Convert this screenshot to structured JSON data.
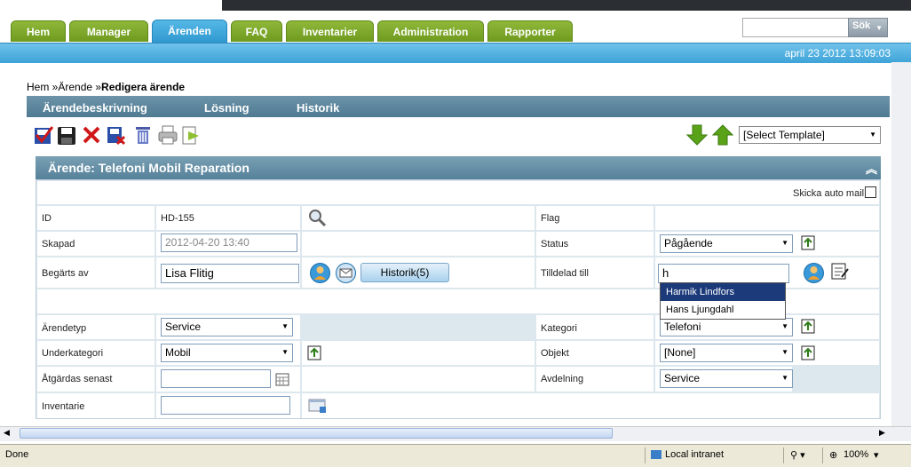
{
  "nav": {
    "tabs": [
      "Hem",
      "Manager",
      "Ärenden",
      "FAQ",
      "Inventarier",
      "Administration",
      "Rapporter"
    ],
    "search_button": "Sök",
    "datetime": "april 23 2012 13:09:03"
  },
  "breadcrumb": {
    "part1": "Hem »",
    "part2": "Ärende »",
    "current": "Redigera ärende"
  },
  "subnav": [
    "Ärendebeskrivning",
    "Lösning",
    "Historik"
  ],
  "template_select": "[Select Template]",
  "panel": {
    "title": "Ärende: Telefoni Mobil Reparation",
    "auto_mail": "Skicka auto mail"
  },
  "form": {
    "id_label": "ID",
    "id_value": "HD-155",
    "skapad_label": "Skapad",
    "skapad_value": "2012-04-20 13:40",
    "begarts_label": "Begärts av",
    "begarts_value": "Lisa Flitig",
    "historik_button": "Historik(5)",
    "flag_label": "Flag",
    "status_label": "Status",
    "status_value": "Pågående",
    "tilldelad_label": "Tilldelad till",
    "tilldelad_value": "h",
    "arendetyp_label": "Ärendetyp",
    "arendetyp_value": "Service",
    "kategori_label": "Kategori",
    "kategori_value": "Telefoni",
    "underkategori_label": "Underkategori",
    "underkategori_value": "Mobil",
    "objekt_label": "Objekt",
    "objekt_value": "[None]",
    "atgardas_label": "Åtgärdas senast",
    "atgardas_value": "",
    "avdelning_label": "Avdelning",
    "avdelning_value": "Service",
    "inventarie_label": "Inventarie",
    "inventarie_value": ""
  },
  "autocomplete": [
    "Harmik Lindfors",
    "Hans Ljungdahl"
  ],
  "statusbar": {
    "left": "Done",
    "zone": "Local intranet",
    "zoom": "100%"
  },
  "colors": {
    "tab_green": "#7aa82a",
    "tab_active": "#3aa3d8",
    "header_blue": "#5f8aa2",
    "autocomplete_highlight": "#1c3a7a"
  }
}
